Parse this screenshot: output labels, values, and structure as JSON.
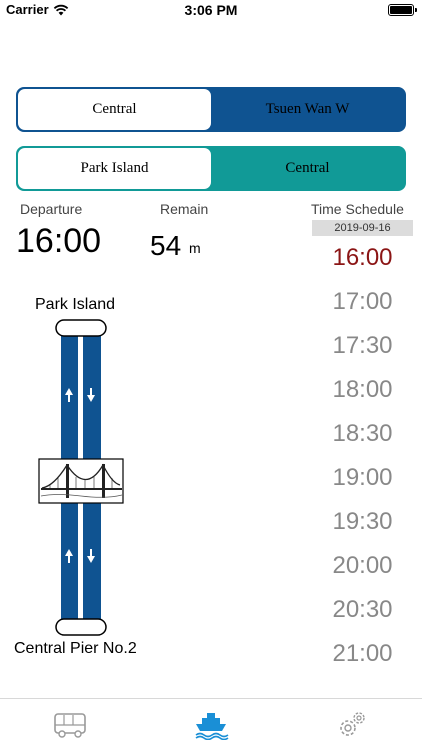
{
  "status_bar": {
    "carrier": "Carrier",
    "time": "3:06 PM"
  },
  "route_selector": {
    "options": [
      "Central",
      "Tsuen Wan W"
    ],
    "selected_index": 0
  },
  "direction_selector": {
    "options": [
      "Park Island",
      "Central"
    ],
    "selected_index": 0
  },
  "departure": {
    "label": "Departure",
    "time": "16:00"
  },
  "remain": {
    "label": "Remain",
    "value": "54",
    "unit": "m"
  },
  "schedule": {
    "label": "Time Schedule",
    "date": "2019-09-16",
    "times": [
      "16:00",
      "17:00",
      "17:30",
      "18:00",
      "18:30",
      "19:00",
      "19:30",
      "20:00",
      "20:30",
      "21:00"
    ],
    "current_index": 0
  },
  "route_map": {
    "origin": "Park Island",
    "destination": "Central Pier No.2"
  },
  "colors": {
    "route_bar": "#0f5391",
    "direction_bar": "#119a97",
    "current_time": "#8b1515",
    "active_tab": "#1a8fd6"
  },
  "tab_bar": {
    "tabs": [
      "bus-icon",
      "ferry-icon",
      "settings-icon"
    ],
    "active_index": 1
  }
}
